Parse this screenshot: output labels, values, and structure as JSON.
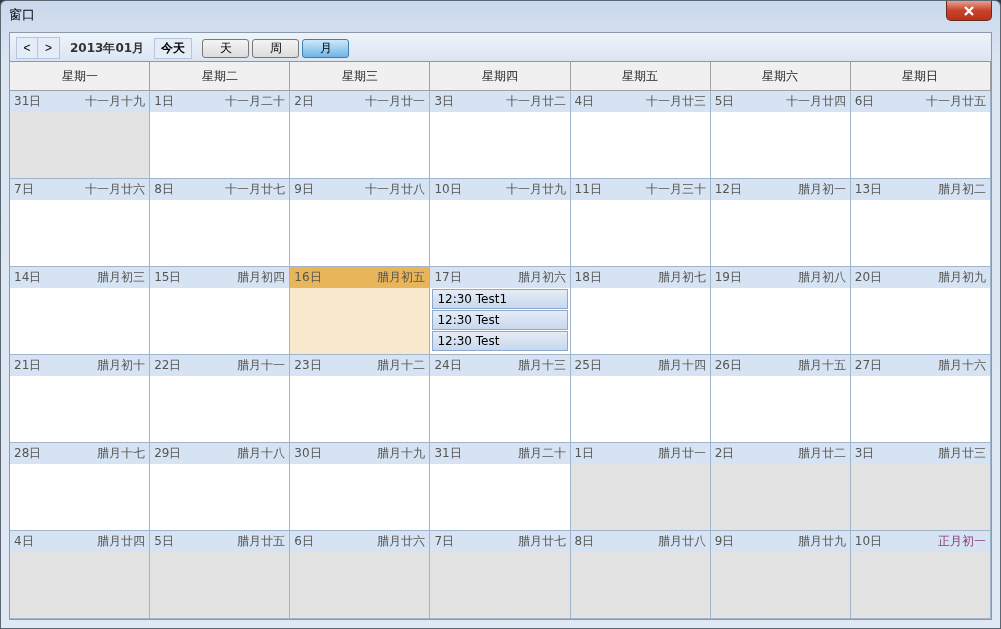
{
  "window": {
    "title": "窗口"
  },
  "toolbar": {
    "prev": "<",
    "next": ">",
    "month_label": "2013年01月",
    "today_button": "今天",
    "views": [
      {
        "label": "天",
        "selected": false
      },
      {
        "label": "周",
        "selected": false
      },
      {
        "label": "月",
        "selected": true
      }
    ]
  },
  "weekdays": [
    "星期一",
    "星期二",
    "星期三",
    "星期四",
    "星期五",
    "星期六",
    "星期日"
  ],
  "weeks": [
    [
      {
        "day": "31日",
        "lunar": "十一月十九",
        "other_month": true,
        "today": false,
        "holiday": false
      },
      {
        "day": "1日",
        "lunar": "十一月二十",
        "other_month": false,
        "today": false,
        "holiday": false
      },
      {
        "day": "2日",
        "lunar": "十一月廿一",
        "other_month": false,
        "today": false,
        "holiday": false
      },
      {
        "day": "3日",
        "lunar": "十一月廿二",
        "other_month": false,
        "today": false,
        "holiday": false
      },
      {
        "day": "4日",
        "lunar": "十一月廿三",
        "other_month": false,
        "today": false,
        "holiday": false
      },
      {
        "day": "5日",
        "lunar": "十一月廿四",
        "other_month": false,
        "today": false,
        "holiday": false
      },
      {
        "day": "6日",
        "lunar": "十一月廿五",
        "other_month": false,
        "today": false,
        "holiday": false
      }
    ],
    [
      {
        "day": "7日",
        "lunar": "十一月廿六",
        "other_month": false,
        "today": false,
        "holiday": false
      },
      {
        "day": "8日",
        "lunar": "十一月廿七",
        "other_month": false,
        "today": false,
        "holiday": false
      },
      {
        "day": "9日",
        "lunar": "十一月廿八",
        "other_month": false,
        "today": false,
        "holiday": false
      },
      {
        "day": "10日",
        "lunar": "十一月廿九",
        "other_month": false,
        "today": false,
        "holiday": false
      },
      {
        "day": "11日",
        "lunar": "十一月三十",
        "other_month": false,
        "today": false,
        "holiday": false
      },
      {
        "day": "12日",
        "lunar": "腊月初一",
        "other_month": false,
        "today": false,
        "holiday": false
      },
      {
        "day": "13日",
        "lunar": "腊月初二",
        "other_month": false,
        "today": false,
        "holiday": false
      }
    ],
    [
      {
        "day": "14日",
        "lunar": "腊月初三",
        "other_month": false,
        "today": false,
        "holiday": false
      },
      {
        "day": "15日",
        "lunar": "腊月初四",
        "other_month": false,
        "today": false,
        "holiday": false
      },
      {
        "day": "16日",
        "lunar": "腊月初五",
        "other_month": false,
        "today": true,
        "holiday": false
      },
      {
        "day": "17日",
        "lunar": "腊月初六",
        "other_month": false,
        "today": false,
        "holiday": false,
        "events": [
          "12:30 Test1",
          "12:30 Test",
          "12:30 Test"
        ]
      },
      {
        "day": "18日",
        "lunar": "腊月初七",
        "other_month": false,
        "today": false,
        "holiday": false
      },
      {
        "day": "19日",
        "lunar": "腊月初八",
        "other_month": false,
        "today": false,
        "holiday": false
      },
      {
        "day": "20日",
        "lunar": "腊月初九",
        "other_month": false,
        "today": false,
        "holiday": false
      }
    ],
    [
      {
        "day": "21日",
        "lunar": "腊月初十",
        "other_month": false,
        "today": false,
        "holiday": false
      },
      {
        "day": "22日",
        "lunar": "腊月十一",
        "other_month": false,
        "today": false,
        "holiday": false
      },
      {
        "day": "23日",
        "lunar": "腊月十二",
        "other_month": false,
        "today": false,
        "holiday": false
      },
      {
        "day": "24日",
        "lunar": "腊月十三",
        "other_month": false,
        "today": false,
        "holiday": false
      },
      {
        "day": "25日",
        "lunar": "腊月十四",
        "other_month": false,
        "today": false,
        "holiday": false
      },
      {
        "day": "26日",
        "lunar": "腊月十五",
        "other_month": false,
        "today": false,
        "holiday": false
      },
      {
        "day": "27日",
        "lunar": "腊月十六",
        "other_month": false,
        "today": false,
        "holiday": false
      }
    ],
    [
      {
        "day": "28日",
        "lunar": "腊月十七",
        "other_month": false,
        "today": false,
        "holiday": false
      },
      {
        "day": "29日",
        "lunar": "腊月十八",
        "other_month": false,
        "today": false,
        "holiday": false
      },
      {
        "day": "30日",
        "lunar": "腊月十九",
        "other_month": false,
        "today": false,
        "holiday": false
      },
      {
        "day": "31日",
        "lunar": "腊月二十",
        "other_month": false,
        "today": false,
        "holiday": false
      },
      {
        "day": "1日",
        "lunar": "腊月廿一",
        "other_month": true,
        "today": false,
        "holiday": false
      },
      {
        "day": "2日",
        "lunar": "腊月廿二",
        "other_month": true,
        "today": false,
        "holiday": false
      },
      {
        "day": "3日",
        "lunar": "腊月廿三",
        "other_month": true,
        "today": false,
        "holiday": false
      }
    ],
    [
      {
        "day": "4日",
        "lunar": "腊月廿四",
        "other_month": true,
        "today": false,
        "holiday": false
      },
      {
        "day": "5日",
        "lunar": "腊月廿五",
        "other_month": true,
        "today": false,
        "holiday": false
      },
      {
        "day": "6日",
        "lunar": "腊月廿六",
        "other_month": true,
        "today": false,
        "holiday": false
      },
      {
        "day": "7日",
        "lunar": "腊月廿七",
        "other_month": true,
        "today": false,
        "holiday": false
      },
      {
        "day": "8日",
        "lunar": "腊月廿八",
        "other_month": true,
        "today": false,
        "holiday": false
      },
      {
        "day": "9日",
        "lunar": "腊月廿九",
        "other_month": true,
        "today": false,
        "holiday": false
      },
      {
        "day": "10日",
        "lunar": "正月初一",
        "other_month": true,
        "today": false,
        "holiday": true
      }
    ]
  ]
}
